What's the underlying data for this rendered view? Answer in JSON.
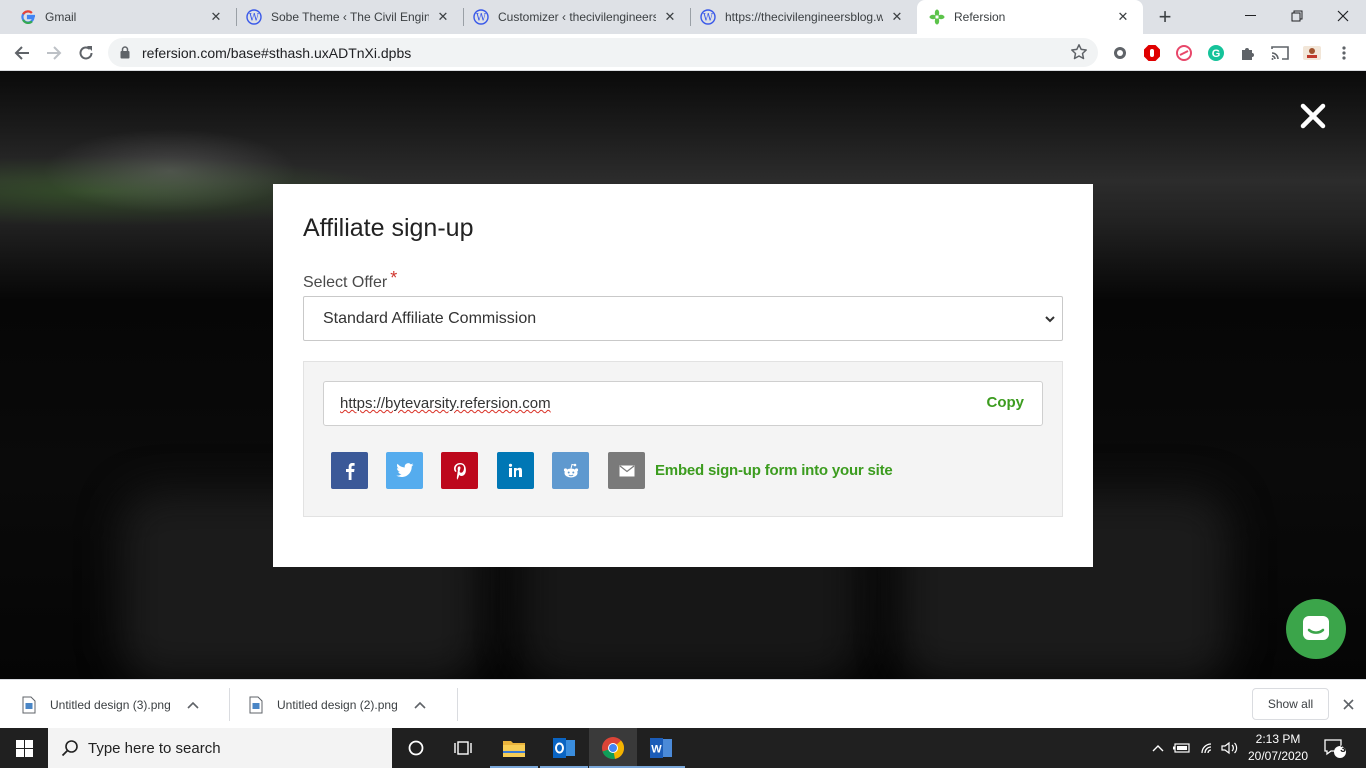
{
  "browser": {
    "tabs": [
      {
        "title": "Gmail",
        "icon": "google-icon"
      },
      {
        "title": "Sobe Theme ‹ The Civil Engine",
        "icon": "wordpress-icon"
      },
      {
        "title": "Customizer ‹ thecivilengineers",
        "icon": "wordpress-icon"
      },
      {
        "title": "https://thecivilengineersblog.w",
        "icon": "wordpress-icon"
      },
      {
        "title": "Refersion",
        "icon": "refersion-icon",
        "active": true
      }
    ],
    "url": "refersion.com/base#sthash.uxADTnXi.dpbs"
  },
  "modal": {
    "title": "Affiliate sign-up",
    "offer_label": "Select Offer",
    "required_mark": "*",
    "offer_value": "Standard Affiliate Commission",
    "affiliate_link": "https://bytevarsity.refersion.com",
    "copy_label": "Copy",
    "embed_label": "Embed sign-up form into your site",
    "social": [
      {
        "name": "facebook",
        "color": "#3b5998"
      },
      {
        "name": "twitter",
        "color": "#55acee"
      },
      {
        "name": "pinterest",
        "color": "#bd081c"
      },
      {
        "name": "linkedin",
        "color": "#0077b5"
      },
      {
        "name": "reddit",
        "color": "#5f99cf"
      },
      {
        "name": "email",
        "color": "#7a7a7a"
      }
    ]
  },
  "downloads": {
    "items": [
      "Untitled design (3).png",
      "Untitled design (2).png"
    ],
    "show_all": "Show all"
  },
  "taskbar": {
    "search_placeholder": "Type here to search",
    "time": "2:13 PM",
    "date": "20/07/2020",
    "notification_count": "3"
  },
  "colors": {
    "accent_green": "#3c9c1f",
    "chat_green": "#3ba54a"
  }
}
